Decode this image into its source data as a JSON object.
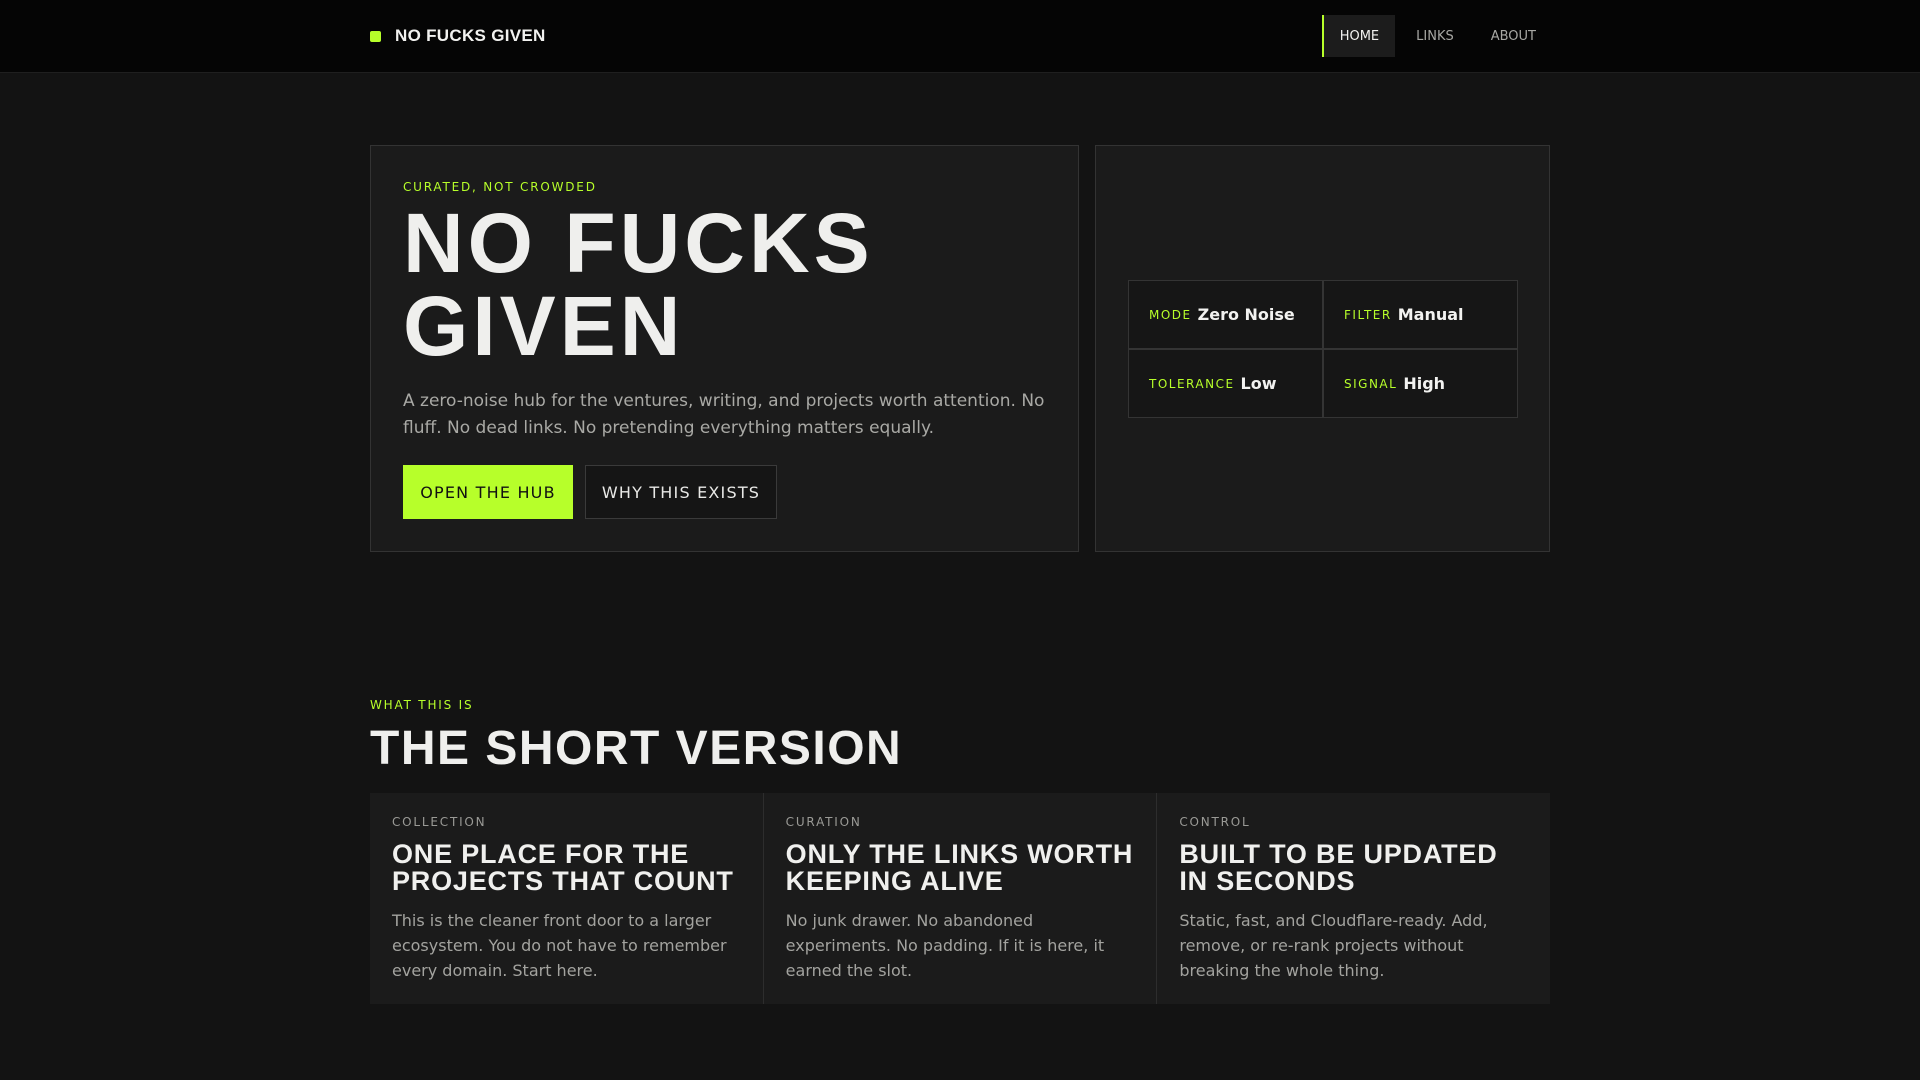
{
  "colors": {
    "accent": "#b7ff2a"
  },
  "header": {
    "brand": "NO FUCKS GIVEN",
    "nav": [
      {
        "label": "HOME",
        "active": true
      },
      {
        "label": "LINKS",
        "active": false
      },
      {
        "label": "ABOUT",
        "active": false
      }
    ]
  },
  "hero": {
    "eyebrow": "CURATED, NOT CROWDED",
    "title": "NO FUCKS GIVEN",
    "description": "A zero-noise hub for the ventures, writing, and projects worth attention. No fluff. No dead links. No pretending everything matters equally.",
    "primary_button": "OPEN THE HUB",
    "secondary_button": "WHY THIS EXISTS"
  },
  "stats": [
    {
      "key": "MODE",
      "value": "Zero Noise"
    },
    {
      "key": "FILTER",
      "value": "Manual"
    },
    {
      "key": "TOLERANCE",
      "value": "Low"
    },
    {
      "key": "SIGNAL",
      "value": "High"
    }
  ],
  "section": {
    "eyebrow": "WHAT THIS IS",
    "title": "THE SHORT VERSION",
    "cards": [
      {
        "kicker": "COLLECTION",
        "title": "ONE PLACE FOR THE PROJECTS THAT COUNT",
        "body": "This is the cleaner front door to a larger ecosystem. You do not have to remember every domain. Start here."
      },
      {
        "kicker": "CURATION",
        "title": "ONLY THE LINKS WORTH KEEPING ALIVE",
        "body": "No junk drawer. No abandoned experiments. No padding. If it is here, it earned the slot."
      },
      {
        "kicker": "CONTROL",
        "title": "BUILT TO BE UPDATED IN SECONDS",
        "body": "Static, fast, and Cloudflare-ready. Add, remove, or re-rank projects without breaking the whole thing."
      }
    ]
  }
}
